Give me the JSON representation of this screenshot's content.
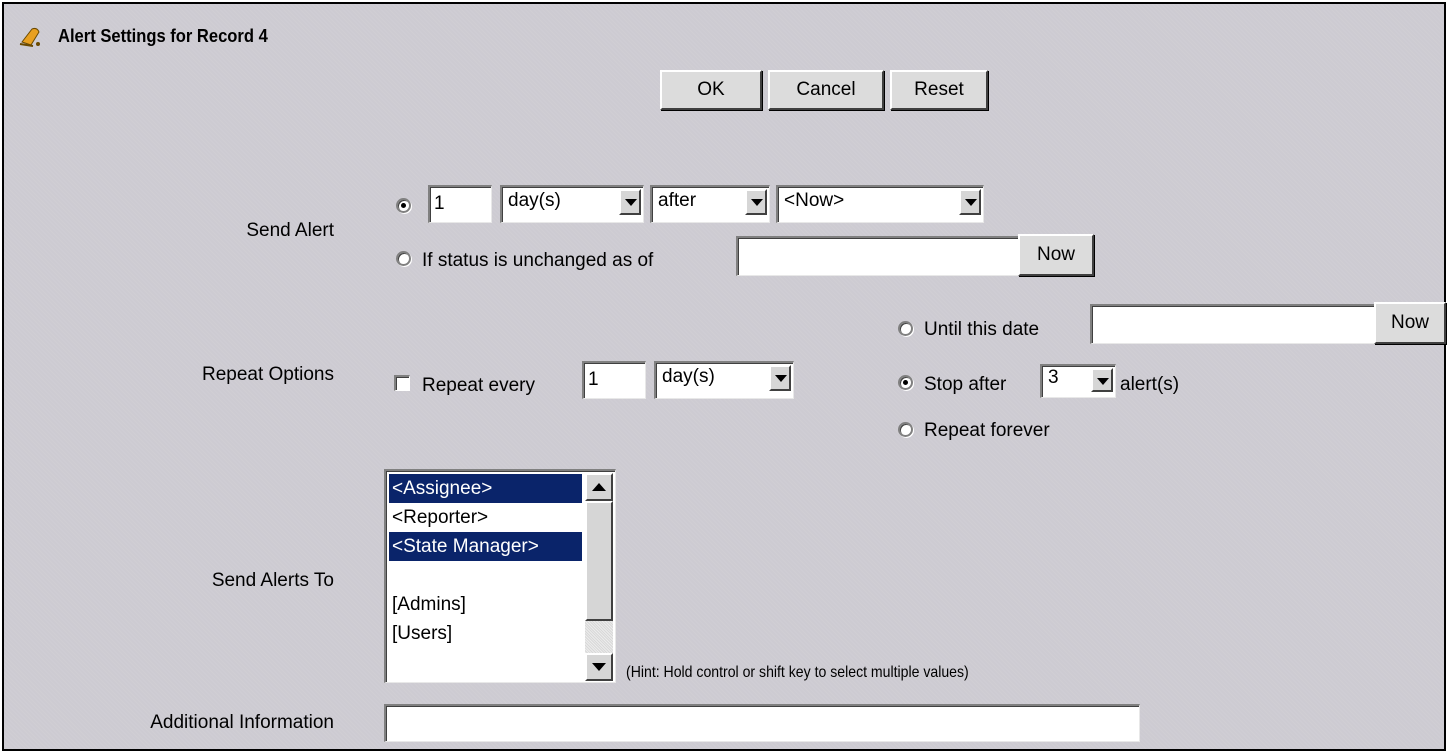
{
  "title": "Alert Settings for Record 4",
  "buttons": {
    "ok": "OK",
    "cancel": "Cancel",
    "reset": "Reset"
  },
  "send_alert": {
    "label": "Send Alert",
    "relative_option_selected": true,
    "amount": "1",
    "unit": "day(s)",
    "direction": "after",
    "reference": "<Now>",
    "status_option_label": "If status is unchanged as of",
    "status_date": "",
    "now_label": "Now"
  },
  "repeat": {
    "label": "Repeat Options",
    "enabled": false,
    "repeat_every_label": "Repeat every",
    "interval": "1",
    "unit": "day(s)",
    "until_label": "Until this date",
    "until_date": "",
    "now_label": "Now",
    "stop_after_prefix": "Stop after",
    "stop_after_count": "3",
    "stop_after_suffix": "alert(s)",
    "forever_label": "Repeat forever",
    "selected_end": "stop_after"
  },
  "recipients": {
    "label": "Send Alerts To",
    "options": [
      {
        "text": "<Assignee>",
        "selected": true
      },
      {
        "text": "<Reporter>",
        "selected": false
      },
      {
        "text": "<State Manager>",
        "selected": true
      },
      {
        "text": "",
        "selected": false
      },
      {
        "text": "[Admins]",
        "selected": false
      },
      {
        "text": "[Users]",
        "selected": false
      }
    ],
    "hint": "(Hint: Hold control or shift key to select multiple values)"
  },
  "additional": {
    "label": "Additional Information",
    "value": ""
  },
  "colors": {
    "panel_bg": "#cdcbd2",
    "selection": "#0a246a",
    "bell": "#e8a020"
  }
}
